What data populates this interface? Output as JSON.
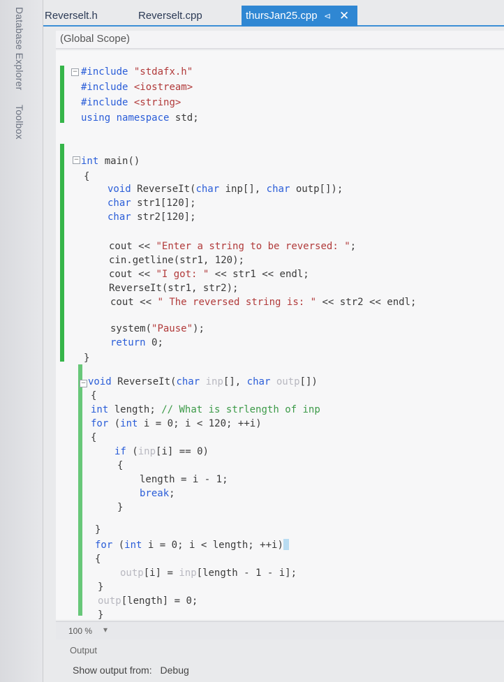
{
  "sidebar": {
    "items": [
      {
        "label": "Database Explorer"
      },
      {
        "label": "Toolbox"
      }
    ]
  },
  "tabs": [
    {
      "label": "Reverselt.h",
      "active": false
    },
    {
      "label": "Reverselt.cpp",
      "active": false
    },
    {
      "label": "thursJan25.cpp",
      "active": true
    }
  ],
  "tab_icons": {
    "pin": "pin-icon",
    "close": "close-icon"
  },
  "scope": {
    "label": "(Global Scope)"
  },
  "colors": {
    "accent": "#2f87d3",
    "change_bar": "#36b54a",
    "keyword": "#2a5dd8",
    "string": "#b13a3a",
    "comment": "#3c9a48"
  },
  "editor": {
    "lines": [
      "#include \"stdafx.h\"",
      "#include <iostream>",
      "#include <string>",
      "using namespace std;",
      "int main()",
      "{",
      "void ReverseIt(char inp[], char outp[]);",
      "char str1[120];",
      "char str2[120];",
      "cout << \"Enter a string to be reversed: \";",
      "cin.getline(str1, 120);",
      "cout << \"I got: \" << str1 << endl;",
      "ReverseIt(str1, str2);",
      "cout << \" The reversed string is: \" << str2 << endl;",
      "system(\"Pause\");",
      "return 0;",
      "}",
      "void ReverseIt(char inp[], char outp[])",
      "{",
      "int length; // What is strlength of inp",
      "for (int i = 0; i < 120; ++i)",
      "{",
      "if (inp[i] == 0)",
      "{",
      "length = i - 1;",
      "break;",
      "}",
      "}",
      "for (int i = 0; i < length; ++i)",
      "{",
      "outp[i] = inp[length - 1 - i];",
      "}",
      "outp[length] = 0;",
      "}"
    ]
  },
  "status": {
    "zoom": "100 %"
  },
  "output": {
    "title": "Output",
    "show_from_label": "Show output from:",
    "show_from_value": "Debug"
  }
}
